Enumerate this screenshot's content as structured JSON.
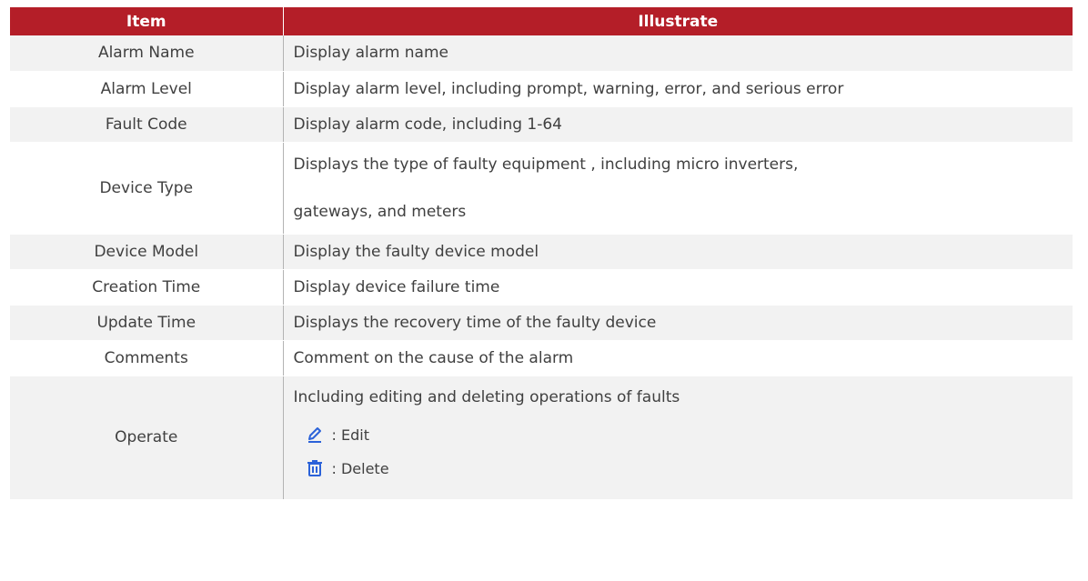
{
  "table": {
    "headers": [
      "Item",
      "Illustrate"
    ],
    "rows": [
      {
        "item": "Alarm Name",
        "desc": "Display alarm name"
      },
      {
        "item": "Alarm Level",
        "desc": "Display alarm level, including prompt, warning, error, and serious error"
      },
      {
        "item": "Fault Code",
        "desc": "Display alarm code, including 1-64"
      },
      {
        "item": "Device Type",
        "desc_line1": "Displays the type of faulty equipment , including micro inverters,",
        "desc_line2": "gateways, and meters"
      },
      {
        "item": "Device Model",
        "desc": "Display the faulty device model"
      },
      {
        "item": "Creation Time",
        "desc": "Display device failure time"
      },
      {
        "item": "Update Time",
        "desc": "Displays the recovery time of the faulty device"
      },
      {
        "item": "Comments",
        "desc": "Comment on the cause of the alarm"
      },
      {
        "item": "Operate",
        "desc": "Including editing and deleting operations of faults",
        "edit_label": ": Edit",
        "delete_label": ": Delete"
      }
    ]
  },
  "icons": {
    "edit": "pencil-icon",
    "delete": "trash-icon"
  },
  "colors": {
    "header_bg": "#b41e28",
    "icon_blue": "#2b62d9",
    "row_shade": "#f2f2f2"
  }
}
